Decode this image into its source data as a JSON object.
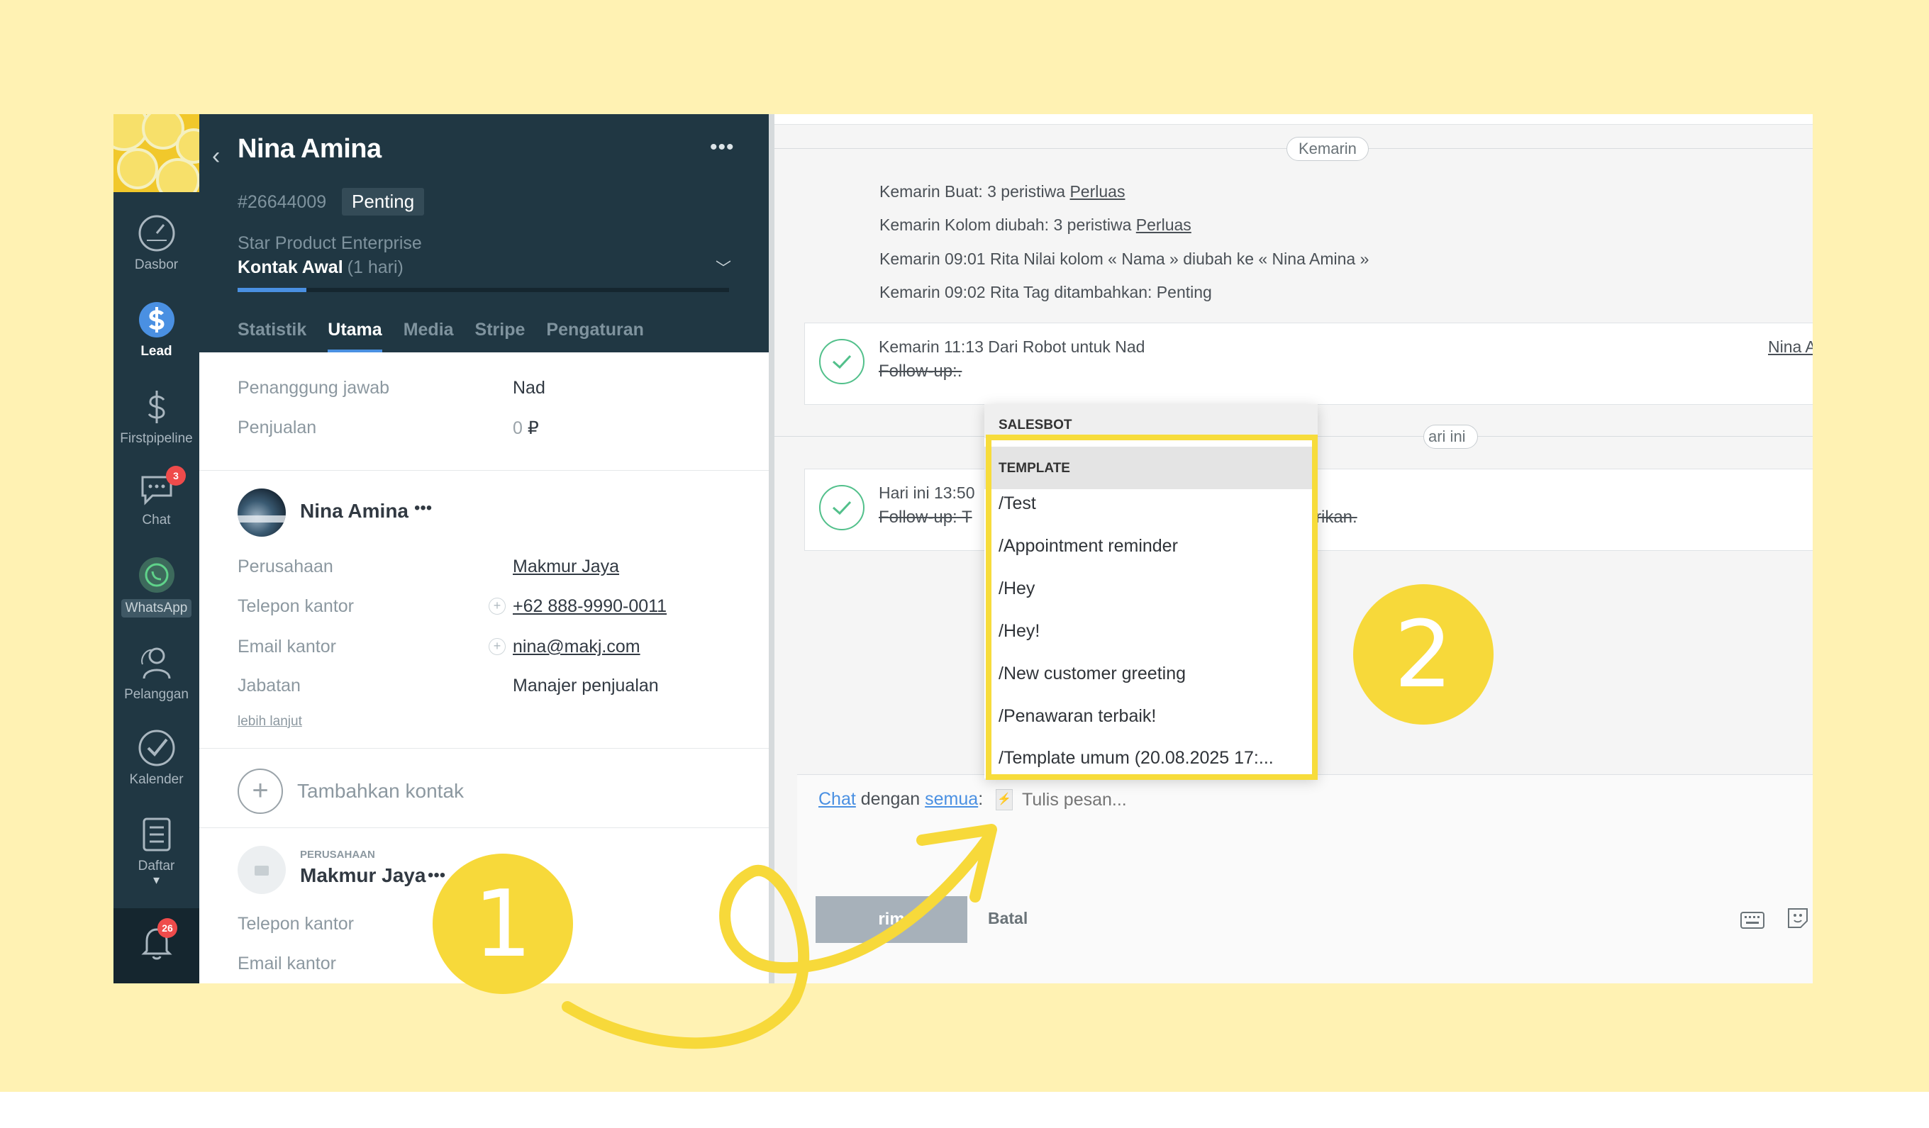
{
  "nav": {
    "items": [
      {
        "label": "Dasbor",
        "icon": "gauge-icon"
      },
      {
        "label": "Lead",
        "icon": "dollar-icon"
      },
      {
        "label": "Firstpipeline",
        "icon": "dollar-outline-icon"
      },
      {
        "label": "Chat",
        "icon": "chat-bubble-icon",
        "badge": "3"
      },
      {
        "label": "WhatsApp",
        "icon": "whatsapp-icon"
      },
      {
        "label": "Pelanggan",
        "icon": "contacts-icon"
      },
      {
        "label": "Kalender",
        "icon": "check-icon"
      },
      {
        "label": "Daftar",
        "icon": "list-icon"
      }
    ],
    "notifications_badge": "26"
  },
  "lead": {
    "name": "Nina Amina",
    "id": "#26644009",
    "tag": "Penting",
    "pipeline": "Star Product Enterprise",
    "stage": "Kontak Awal",
    "stage_duration": "(1 hari)",
    "stage_progress": 0.14,
    "tabs": [
      "Statistik",
      "Utama",
      "Media",
      "Stripe",
      "Pengaturan"
    ],
    "active_tab": "Utama",
    "fields": {
      "responsible_label": "Penanggung jawab",
      "responsible_value": "Nad",
      "sale_label": "Penjualan",
      "sale_value": "0",
      "currency": "₽"
    }
  },
  "contact": {
    "name": "Nina Amina",
    "company_label": "Perusahaan",
    "company_value": "Makmur Jaya",
    "phone_label": "Telepon kantor",
    "phone_value": "+62 888-9990-0011",
    "email_label": "Email kantor",
    "email_value": "nina@makj.com",
    "position_label": "Jabatan",
    "position_value": "Manajer penjualan",
    "more_link": "lebih lanjut",
    "add_contact": "Tambahkan kontak"
  },
  "company": {
    "caption": "PERUSAHAAN",
    "name": "Makmur Jaya",
    "phone_label": "Telepon kantor",
    "phone_value": "...",
    "email_label": "Email kantor",
    "email_value": "..."
  },
  "feed": {
    "yesterday_pill": "Kemarin",
    "today_pill_partial": "ari ini",
    "events": [
      {
        "text": "Kemarin Buat: 3 peristiwa ",
        "link": "Perluas"
      },
      {
        "text": "Kemarin Kolom diubah: 3 peristiwa ",
        "link": "Perluas"
      },
      {
        "text": "Kemarin 09:01 Rita Nilai kolom « Nama » diubah ke « Nina Amina »",
        "link": ""
      },
      {
        "text": "Kemarin 09:02 Rita Tag ditambahkan: Penting",
        "link": ""
      }
    ],
    "note1": {
      "meta": "Kemarin 11:13  Dari Robot untuk Nad",
      "text": "Follow-up:.",
      "right_link": "Nina A"
    },
    "note2": {
      "meta": "Hari ini 13:50",
      "text_left": "Follow-up: T",
      "text_right": "rikan."
    }
  },
  "composer": {
    "chat_link": "Chat",
    "with_text": "dengan",
    "audience_link": "semua",
    "colon": ":",
    "placeholder": "Tulis pesan...",
    "send_label": "Kirim",
    "send_visible": "rim",
    "cancel_label": "Batal"
  },
  "dropdown": {
    "salesbot_header": "SALESBOT",
    "template_header": "TEMPLATE",
    "items": [
      "/Test",
      "/Appointment reminder",
      "/Hey",
      "/Hey!",
      "/New customer greeting",
      "/Penawaran terbaik!",
      "/Template umum (20.08.2025 17:..."
    ]
  },
  "markers": {
    "first": "1",
    "second": "2"
  },
  "colors": {
    "background": "#fff2b3",
    "sidebar": "#203743",
    "accent": "#4a90e2",
    "highlight": "#f7dc3b",
    "marker": "#f7d93a"
  }
}
